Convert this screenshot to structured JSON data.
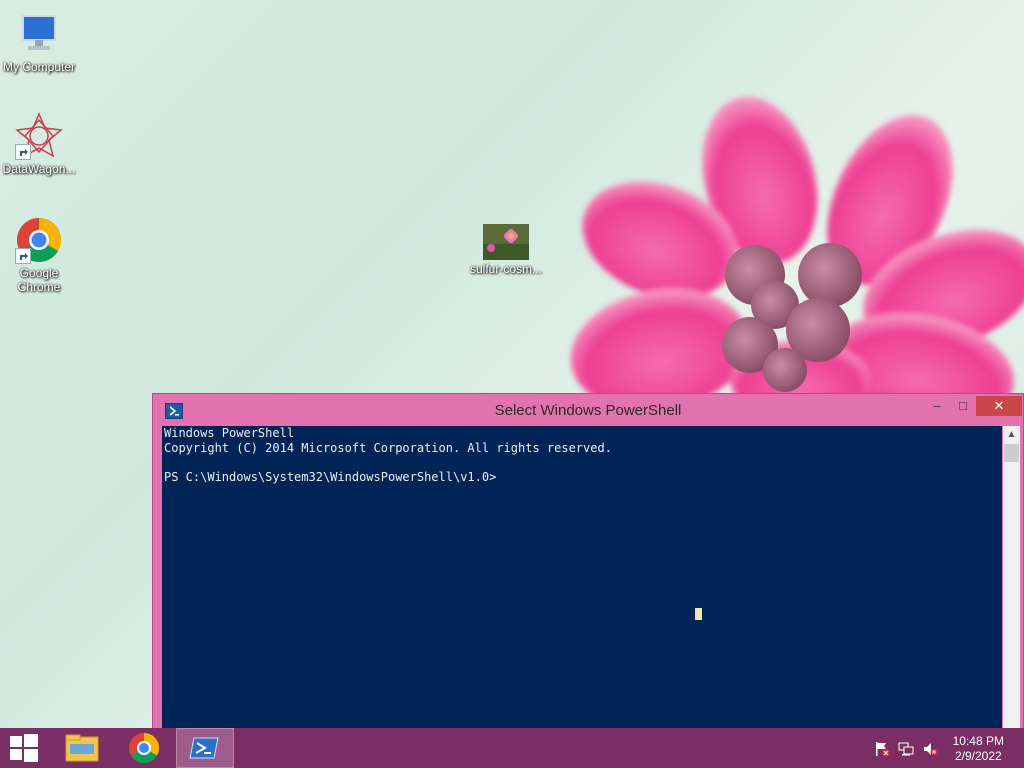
{
  "desktop": {
    "icons": [
      {
        "label": "My Computer",
        "icon": "computer-icon"
      },
      {
        "label": "DataWagon...",
        "icon": "datawagon-icon"
      },
      {
        "label": "Google Chrome",
        "icon": "chrome-icon"
      },
      {
        "label": "sulfur-cosm...",
        "icon": "image-thumbnail-icon"
      }
    ]
  },
  "window": {
    "title": "Select Windows PowerShell",
    "buttons": {
      "minimize": "–",
      "maximize": "□",
      "close": "✕"
    },
    "console_lines": [
      "Windows PowerShell",
      "Copyright (C) 2014 Microsoft Corporation. All rights reserved.",
      "",
      "PS C:\\Windows\\System32\\WindowsPowerShell\\v1.0>"
    ]
  },
  "taskbar": {
    "start": "start-icon",
    "apps": [
      "file-explorer-icon",
      "chrome-icon",
      "powershell-icon"
    ],
    "tray": [
      "action-center-flag-icon",
      "network-icon",
      "volume-muted-icon"
    ],
    "time": "10:48 PM",
    "date": "2/9/2022"
  },
  "colors": {
    "console_bg": "#012456",
    "window_frame": "#e273ae",
    "taskbar": "#7b2e63"
  }
}
